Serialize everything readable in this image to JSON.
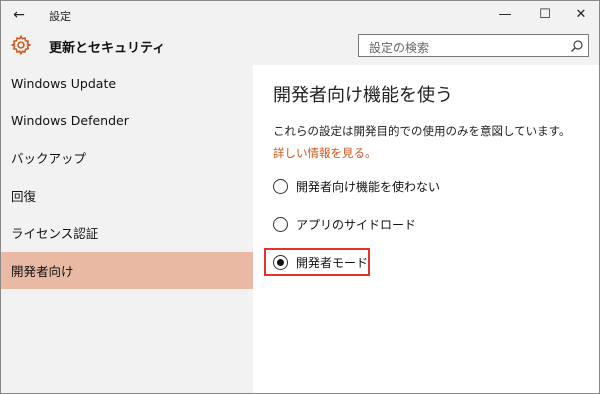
{
  "titlebar": {
    "back_icon": "←",
    "title": "設定",
    "minimize_icon": "—",
    "maximize_icon": "☐",
    "close_icon": "✕"
  },
  "header": {
    "icon": "gear-icon",
    "title": "更新とセキュリティ",
    "accent_color": "#d0541a"
  },
  "search": {
    "placeholder": "設定の検索",
    "icon": "search-icon"
  },
  "sidebar": {
    "selected_color": "#e9b9a3",
    "items": [
      {
        "label": "Windows Update"
      },
      {
        "label": "Windows Defender"
      },
      {
        "label": "バックアップ"
      },
      {
        "label": "回復"
      },
      {
        "label": "ライセンス認証"
      },
      {
        "label": "開発者向け",
        "selected": true
      }
    ]
  },
  "main": {
    "title": "開発者向け機能を使う",
    "description": "これらの設定は開発目的での使用のみを意図しています。",
    "link_text": "詳しい情報を見る。",
    "link_color": "#d0541a",
    "options": [
      {
        "label": "開発者向け機能を使わない",
        "checked": false
      },
      {
        "label": "アプリのサイドロード",
        "checked": false
      },
      {
        "label": "開発者モード",
        "checked": true
      }
    ],
    "highlight_color": "#e0342c"
  }
}
